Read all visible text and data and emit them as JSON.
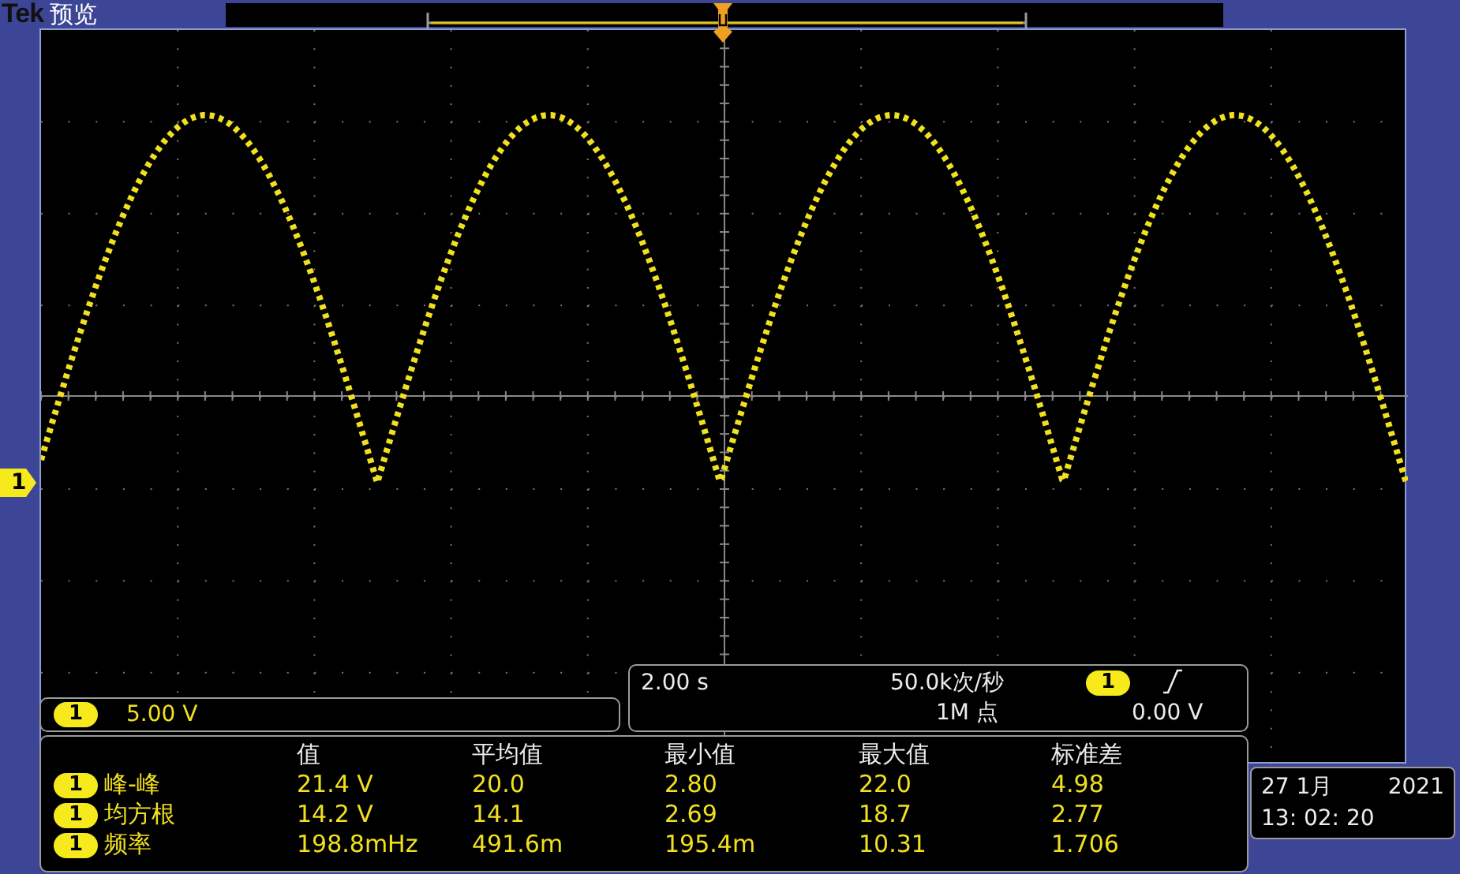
{
  "header": {
    "brand": "Tek",
    "mode": "预览"
  },
  "channel_marker": {
    "label": "1"
  },
  "channel_scale": {
    "channel": "1",
    "scale": "5.00 V"
  },
  "timebase": {
    "time_per_div": "2.00 s",
    "sample_rate": "50.0k次/秒",
    "trigger_channel": "1",
    "record_length": "1M 点",
    "trigger_level": "0.00 V"
  },
  "measurements": {
    "columns": [
      "值",
      "平均值",
      "最小值",
      "最大值",
      "标准差"
    ],
    "rows": [
      {
        "channel": "1",
        "name": "峰-峰",
        "values": [
          "21.4 V",
          "20.0",
          "2.80",
          "22.0",
          "4.98"
        ]
      },
      {
        "channel": "1",
        "name": "均方根",
        "values": [
          "14.2 V",
          "14.1",
          "2.69",
          "18.7",
          "2.77"
        ]
      },
      {
        "channel": "1",
        "name": "频率",
        "values": [
          "198.8mHz",
          "491.6m",
          "195.4m",
          "10.31",
          "1.706"
        ]
      }
    ]
  },
  "datetime": {
    "date": "27 1月",
    "year": "2021",
    "time": "13: 02: 20"
  }
}
